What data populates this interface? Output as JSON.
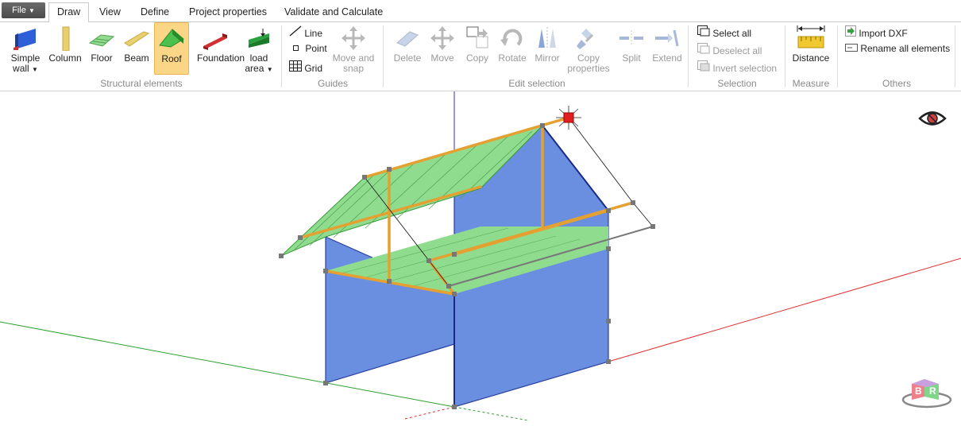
{
  "file_menu": "File",
  "tabs": [
    {
      "label": "Draw"
    },
    {
      "label": "View"
    },
    {
      "label": "Define"
    },
    {
      "label": "Project properties"
    },
    {
      "label": "Validate and Calculate"
    }
  ],
  "ribbon": {
    "structural": {
      "group": "Structural elements",
      "simple_wall_1": "Simple",
      "simple_wall_2": "wall",
      "column": "Column",
      "floor": "Floor",
      "beam": "Beam",
      "roof": "Roof",
      "foundation": "Foundation",
      "load_area_1": "load",
      "load_area_2": "area"
    },
    "guides": {
      "group": "Guides",
      "line": "Line",
      "point": "Point",
      "grid": "Grid",
      "move_snap_1": "Move and",
      "move_snap_2": "snap"
    },
    "edit": {
      "group": "Edit selection",
      "delete": "Delete",
      "move": "Move",
      "copy": "Copy",
      "rotate": "Rotate",
      "mirror": "Mirror",
      "copy_props_1": "Copy",
      "copy_props_2": "properties",
      "split": "Split",
      "extend": "Extend"
    },
    "selection": {
      "group": "Selection",
      "select_all": "Select all",
      "deselect_all": "Deselect all",
      "invert": "Invert selection"
    },
    "measure": {
      "group": "Measure",
      "distance": "Distance"
    },
    "others": {
      "group": "Others",
      "import_dxf": "Import DXF",
      "rename_all": "Rename all elements"
    }
  },
  "viewcube": {
    "left": "B",
    "right": "R"
  },
  "colors": {
    "wall": "#6a8fe0",
    "roof": "#8fdc8f",
    "beam": "#e4a030",
    "axis_x": "#e03030",
    "axis_y": "#30a030",
    "axis_z": "#3030d0",
    "selected_ribbon": "#fbd686"
  }
}
